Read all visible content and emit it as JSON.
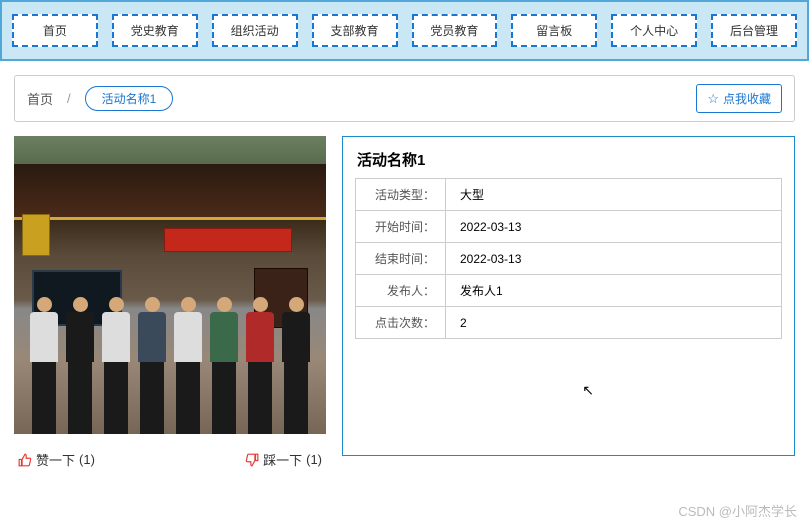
{
  "nav": {
    "items": [
      {
        "label": "首页"
      },
      {
        "label": "党史教育"
      },
      {
        "label": "组织活动"
      },
      {
        "label": "支部教育"
      },
      {
        "label": "党员教育"
      },
      {
        "label": "留言板"
      },
      {
        "label": "个人中心"
      },
      {
        "label": "后台管理"
      }
    ]
  },
  "breadcrumb": {
    "home": "首页",
    "sep": "/",
    "current": "活动名称1"
  },
  "favorite": {
    "label": "点我收藏"
  },
  "vote": {
    "up_label": "赞一下",
    "up_count": "(1)",
    "down_label": "踩一下",
    "down_count": "(1)"
  },
  "detail": {
    "title": "活动名称1",
    "rows": [
      {
        "label": "活动类型：",
        "value": "大型"
      },
      {
        "label": "开始时间：",
        "value": "2022-03-13"
      },
      {
        "label": "结束时间：",
        "value": "2022-03-13"
      },
      {
        "label": "发布人：",
        "value": "发布人1"
      },
      {
        "label": "点击次数：",
        "value": "2"
      }
    ]
  },
  "people_colors": [
    "#ddd",
    "#1a1a1a",
    "#ddd",
    "#3a4a5a",
    "#ddd",
    "#3a6a4a",
    "#b02a2a",
    "#1a1a1a"
  ],
  "watermark": "CSDN @小阿杰学长"
}
